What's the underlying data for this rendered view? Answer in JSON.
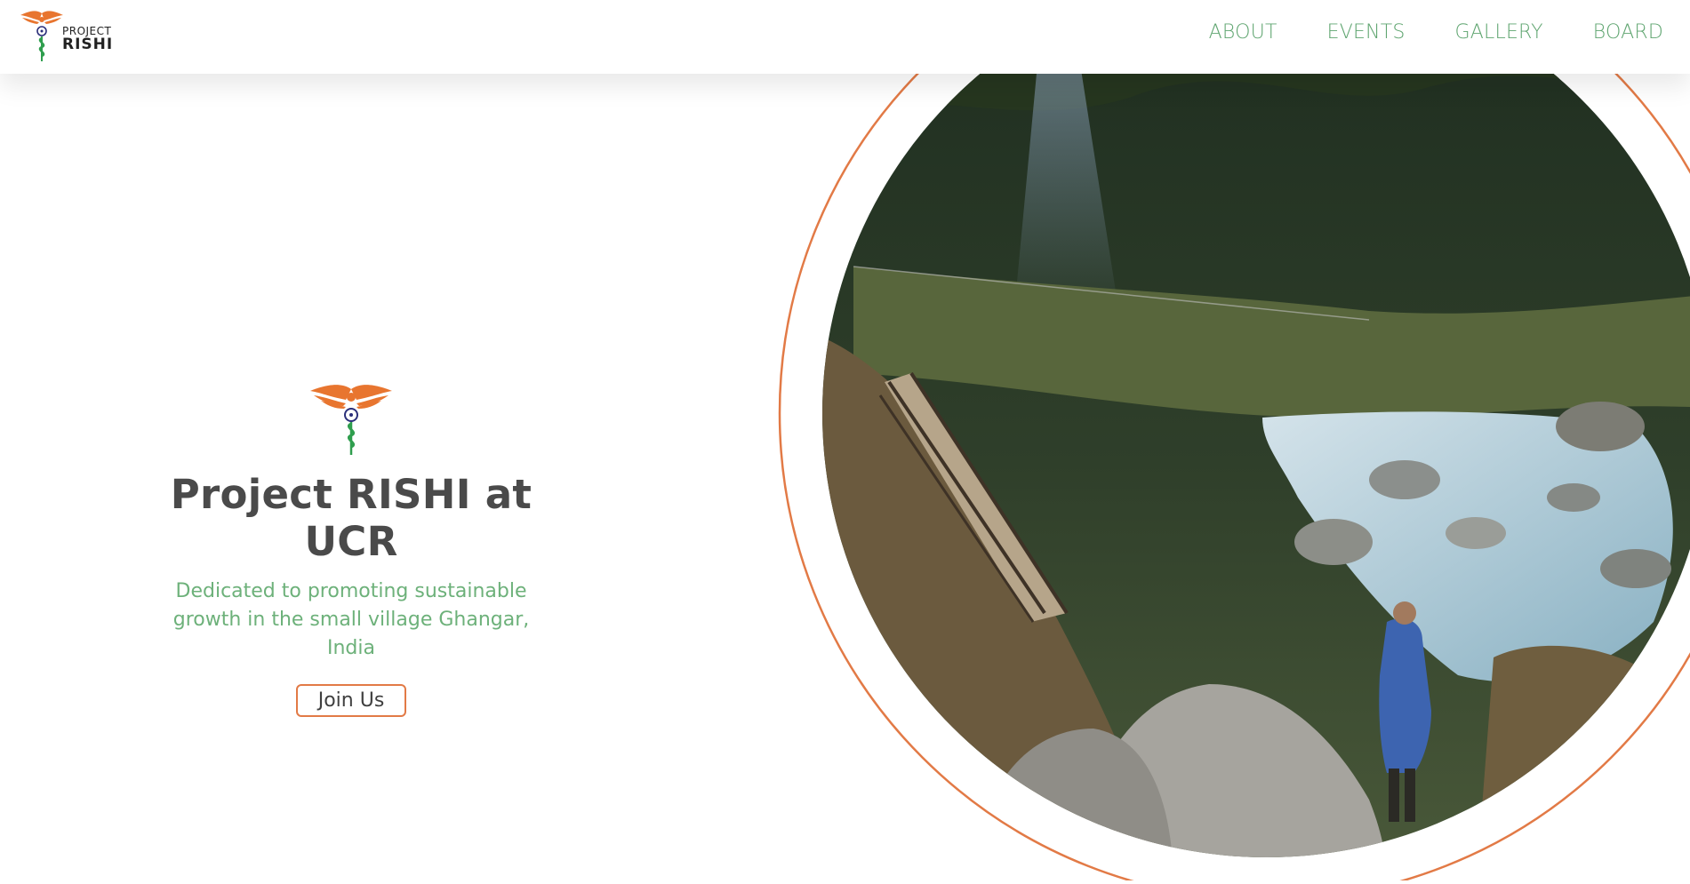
{
  "header": {
    "logo": {
      "line1": "PROJECT",
      "line2": "RISHI"
    },
    "nav": [
      {
        "label": "ABOUT"
      },
      {
        "label": "EVENTS"
      },
      {
        "label": "GALLERY"
      },
      {
        "label": "BOARD"
      }
    ]
  },
  "hero": {
    "title": "Project RISHI at UCR",
    "subtitle": "Dedicated to promoting sustainable\ngrowth in the small village Ghangar, India",
    "cta_label": "Join Us"
  },
  "colors": {
    "accent_orange": "#e27a46",
    "nav_green": "#5fa570",
    "subtitle_green": "#6db17a",
    "title_gray": "#4a4a4a"
  },
  "icons": [
    "caduceus-logo-icon",
    "ashoka-chakra-icon"
  ]
}
